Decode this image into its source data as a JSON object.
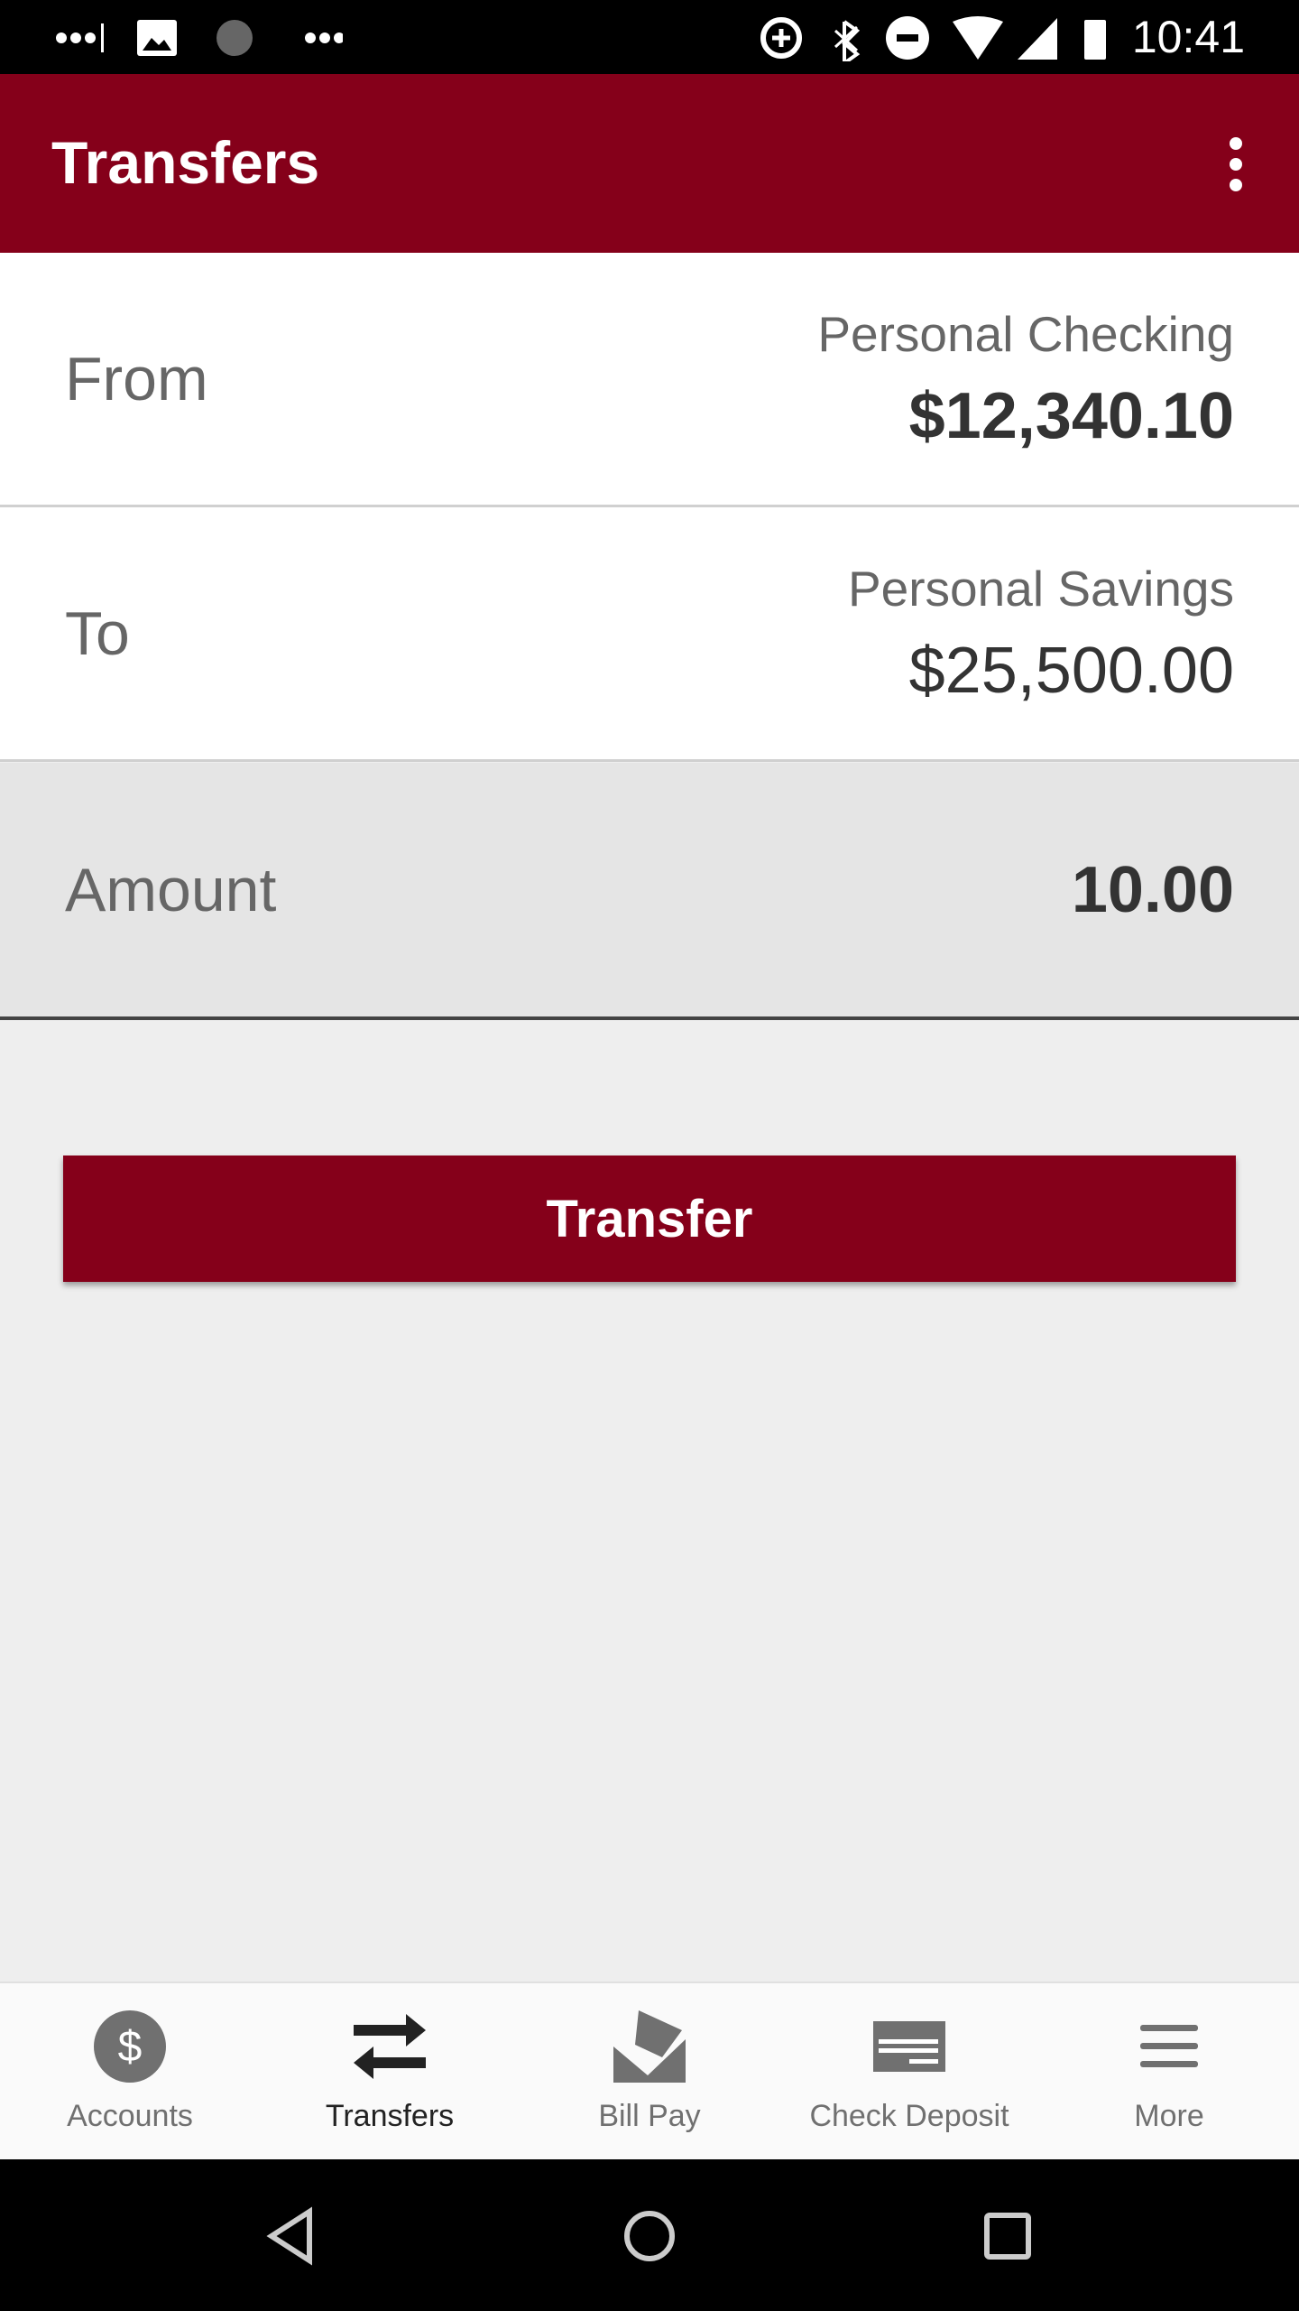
{
  "status_bar": {
    "time": "10:41",
    "icons": [
      "signal-dots-icon",
      "image-icon",
      "loading-icon",
      "signal-dots-icon",
      "data-saver-icon",
      "bluetooth-icon",
      "do-not-disturb-icon",
      "wifi-icon",
      "cell-signal-icon",
      "battery-charging-icon"
    ]
  },
  "app_bar": {
    "title": "Transfers",
    "menu_icon": "more-vert-icon"
  },
  "from": {
    "label": "From",
    "account": "Personal Checking",
    "balance": "$12,340.10"
  },
  "to": {
    "label": "To",
    "account": "Personal Savings",
    "balance": "$25,500.00"
  },
  "amount": {
    "label": "Amount",
    "value": "10.00"
  },
  "transfer_button": "Transfer",
  "bottom_nav": {
    "items": [
      {
        "label": "Accounts",
        "icon": "dollar-icon"
      },
      {
        "label": "Transfers",
        "icon": "transfer-arrows-icon",
        "active": true
      },
      {
        "label": "Bill Pay",
        "icon": "bill-pay-icon"
      },
      {
        "label": "Check Deposit",
        "icon": "check-icon"
      },
      {
        "label": "More",
        "icon": "menu-icon"
      }
    ]
  },
  "colors": {
    "brand": "#85001a",
    "background": "#eeeeee"
  }
}
